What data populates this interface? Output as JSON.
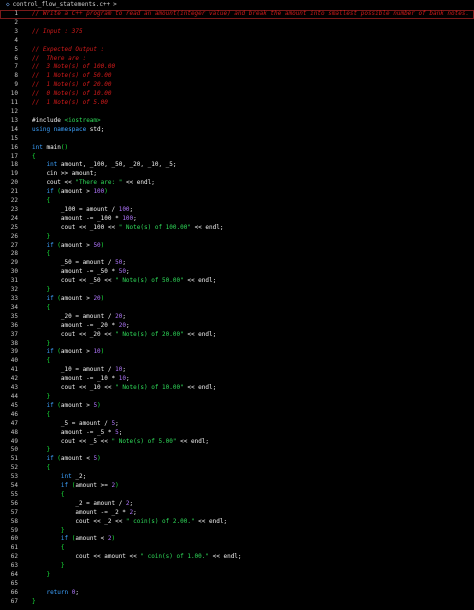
{
  "breadcrumb": {
    "icon": "cpp-file-icon",
    "file_name": "control_flow_statements.c++",
    "separator": ">"
  },
  "colors": {
    "comment": "#d11a1a",
    "keyword": "#3da2ff",
    "number": "#b277ff",
    "string": "#2fdc5a",
    "bracket": "#18e63a",
    "text": "#f2f2f2",
    "background": "#000000"
  },
  "lines": [
    {
      "n": "1",
      "t": [
        [
          "comment",
          "// Write a C++ program to read an amount(integer value) and break the amount into smallest possible number of bank notes."
        ]
      ]
    },
    {
      "n": "2",
      "t": []
    },
    {
      "n": "3",
      "t": [
        [
          "comment",
          "// Input : 375"
        ]
      ]
    },
    {
      "n": "4",
      "t": []
    },
    {
      "n": "5",
      "t": [
        [
          "comment",
          "// Expected Output :"
        ]
      ]
    },
    {
      "n": "6",
      "t": [
        [
          "comment",
          "//  There are :"
        ]
      ]
    },
    {
      "n": "7",
      "t": [
        [
          "comment",
          "//  3 Note(s) of 100.00"
        ]
      ]
    },
    {
      "n": "8",
      "t": [
        [
          "comment",
          "//  1 Note(s) of 50.00"
        ]
      ]
    },
    {
      "n": "9",
      "t": [
        [
          "comment",
          "//  1 Note(s) of 20.00"
        ]
      ]
    },
    {
      "n": "10",
      "t": [
        [
          "comment",
          "//  0 Note(s) of 10.00"
        ]
      ]
    },
    {
      "n": "11",
      "t": [
        [
          "comment",
          "//  1 Note(s) of 5.00"
        ]
      ]
    },
    {
      "n": "12",
      "t": []
    },
    {
      "n": "13",
      "t": [
        [
          "pre",
          "#include "
        ],
        [
          "inc",
          "<iostream>"
        ]
      ]
    },
    {
      "n": "14",
      "t": [
        [
          "kw",
          "using namespace "
        ],
        [
          "plain",
          "std;"
        ]
      ]
    },
    {
      "n": "15",
      "t": []
    },
    {
      "n": "16",
      "t": [
        [
          "kw",
          "int "
        ],
        [
          "fn",
          "main"
        ],
        [
          "br",
          "()"
        ]
      ]
    },
    {
      "n": "17",
      "t": [
        [
          "br",
          "{"
        ]
      ]
    },
    {
      "n": "18",
      "t": [
        [
          "plain",
          "    "
        ],
        [
          "kw",
          "int "
        ],
        [
          "plain",
          "amount, _100, _50, _20, _10, _5;"
        ]
      ]
    },
    {
      "n": "19",
      "t": [
        [
          "plain",
          "    cin >> amount;"
        ]
      ]
    },
    {
      "n": "20",
      "t": [
        [
          "plain",
          "    cout << "
        ],
        [
          "str",
          "\"There are: \""
        ],
        [
          "plain",
          " << endl;"
        ]
      ]
    },
    {
      "n": "21",
      "t": [
        [
          "plain",
          "    "
        ],
        [
          "kw",
          "if "
        ],
        [
          "br",
          "("
        ],
        [
          "plain",
          "amount > "
        ],
        [
          "num",
          "100"
        ],
        [
          "br",
          ")"
        ]
      ]
    },
    {
      "n": "22",
      "t": [
        [
          "plain",
          "    "
        ],
        [
          "br",
          "{"
        ]
      ]
    },
    {
      "n": "23",
      "t": [
        [
          "plain",
          "        _100 = amount / "
        ],
        [
          "num",
          "100"
        ],
        [
          "plain",
          ";"
        ]
      ]
    },
    {
      "n": "24",
      "t": [
        [
          "plain",
          "        amount -= _100 * "
        ],
        [
          "num",
          "100"
        ],
        [
          "plain",
          ";"
        ]
      ]
    },
    {
      "n": "25",
      "t": [
        [
          "plain",
          "        cout << _100 << "
        ],
        [
          "str",
          "\" Note(s) of 100.00\""
        ],
        [
          "plain",
          " << endl;"
        ]
      ]
    },
    {
      "n": "26",
      "t": [
        [
          "plain",
          "    "
        ],
        [
          "br",
          "}"
        ]
      ]
    },
    {
      "n": "27",
      "t": [
        [
          "plain",
          "    "
        ],
        [
          "kw",
          "if "
        ],
        [
          "br",
          "("
        ],
        [
          "plain",
          "amount > "
        ],
        [
          "num",
          "50"
        ],
        [
          "br",
          ")"
        ]
      ]
    },
    {
      "n": "28",
      "t": [
        [
          "plain",
          "    "
        ],
        [
          "br",
          "{"
        ]
      ]
    },
    {
      "n": "29",
      "t": [
        [
          "plain",
          "        _50 = amount / "
        ],
        [
          "num",
          "50"
        ],
        [
          "plain",
          ";"
        ]
      ]
    },
    {
      "n": "30",
      "t": [
        [
          "plain",
          "        amount -= _50 * "
        ],
        [
          "num",
          "50"
        ],
        [
          "plain",
          ";"
        ]
      ]
    },
    {
      "n": "31",
      "t": [
        [
          "plain",
          "        cout << _50 << "
        ],
        [
          "str",
          "\" Note(s) of 50.00\""
        ],
        [
          "plain",
          " << endl;"
        ]
      ]
    },
    {
      "n": "32",
      "t": [
        [
          "plain",
          "    "
        ],
        [
          "br",
          "}"
        ]
      ]
    },
    {
      "n": "33",
      "t": [
        [
          "plain",
          "    "
        ],
        [
          "kw",
          "if "
        ],
        [
          "br",
          "("
        ],
        [
          "plain",
          "amount > "
        ],
        [
          "num",
          "20"
        ],
        [
          "br",
          ")"
        ]
      ]
    },
    {
      "n": "34",
      "t": [
        [
          "plain",
          "    "
        ],
        [
          "br",
          "{"
        ]
      ]
    },
    {
      "n": "35",
      "t": [
        [
          "plain",
          "        _20 = amount / "
        ],
        [
          "num",
          "20"
        ],
        [
          "plain",
          ";"
        ]
      ]
    },
    {
      "n": "36",
      "t": [
        [
          "plain",
          "        amount -= _20 * "
        ],
        [
          "num",
          "20"
        ],
        [
          "plain",
          ";"
        ]
      ]
    },
    {
      "n": "37",
      "t": [
        [
          "plain",
          "        cout << _20 << "
        ],
        [
          "str",
          "\" Note(s) of 20.00\""
        ],
        [
          "plain",
          " << endl;"
        ]
      ]
    },
    {
      "n": "38",
      "t": [
        [
          "plain",
          "    "
        ],
        [
          "br",
          "}"
        ]
      ]
    },
    {
      "n": "39",
      "t": [
        [
          "plain",
          "    "
        ],
        [
          "kw",
          "if "
        ],
        [
          "br",
          "("
        ],
        [
          "plain",
          "amount > "
        ],
        [
          "num",
          "10"
        ],
        [
          "br",
          ")"
        ]
      ]
    },
    {
      "n": "40",
      "t": [
        [
          "plain",
          "    "
        ],
        [
          "br",
          "{"
        ]
      ]
    },
    {
      "n": "41",
      "t": [
        [
          "plain",
          "        _10 = amount / "
        ],
        [
          "num",
          "10"
        ],
        [
          "plain",
          ";"
        ]
      ]
    },
    {
      "n": "42",
      "t": [
        [
          "plain",
          "        amount -= _10 * "
        ],
        [
          "num",
          "10"
        ],
        [
          "plain",
          ";"
        ]
      ]
    },
    {
      "n": "43",
      "t": [
        [
          "plain",
          "        cout << _10 << "
        ],
        [
          "str",
          "\" Note(s) of 10.00\""
        ],
        [
          "plain",
          " << endl;"
        ]
      ]
    },
    {
      "n": "44",
      "t": [
        [
          "plain",
          "    "
        ],
        [
          "br",
          "}"
        ]
      ]
    },
    {
      "n": "45",
      "t": [
        [
          "plain",
          "    "
        ],
        [
          "kw",
          "if "
        ],
        [
          "br",
          "("
        ],
        [
          "plain",
          "amount > "
        ],
        [
          "num",
          "5"
        ],
        [
          "br",
          ")"
        ]
      ]
    },
    {
      "n": "46",
      "t": [
        [
          "plain",
          "    "
        ],
        [
          "br",
          "{"
        ]
      ]
    },
    {
      "n": "47",
      "t": [
        [
          "plain",
          "        _5 = amount / "
        ],
        [
          "num",
          "5"
        ],
        [
          "plain",
          ";"
        ]
      ]
    },
    {
      "n": "48",
      "t": [
        [
          "plain",
          "        amount -= _5 * "
        ],
        [
          "num",
          "5"
        ],
        [
          "plain",
          ";"
        ]
      ]
    },
    {
      "n": "49",
      "t": [
        [
          "plain",
          "        cout << _5 << "
        ],
        [
          "str",
          "\" Note(s) of 5.00\""
        ],
        [
          "plain",
          " << endl;"
        ]
      ]
    },
    {
      "n": "50",
      "t": [
        [
          "plain",
          "    "
        ],
        [
          "br",
          "}"
        ]
      ]
    },
    {
      "n": "51",
      "t": [
        [
          "plain",
          "    "
        ],
        [
          "kw",
          "if "
        ],
        [
          "br",
          "("
        ],
        [
          "plain",
          "amount < "
        ],
        [
          "num",
          "5"
        ],
        [
          "br",
          ")"
        ]
      ]
    },
    {
      "n": "52",
      "t": [
        [
          "plain",
          "    "
        ],
        [
          "br",
          "{"
        ]
      ]
    },
    {
      "n": "53",
      "t": [
        [
          "plain",
          "        "
        ],
        [
          "kw",
          "int "
        ],
        [
          "plain",
          "_2;"
        ]
      ]
    },
    {
      "n": "54",
      "t": [
        [
          "plain",
          "        "
        ],
        [
          "kw",
          "if "
        ],
        [
          "br",
          "("
        ],
        [
          "plain",
          "amount >= "
        ],
        [
          "num",
          "2"
        ],
        [
          "br",
          ")"
        ]
      ]
    },
    {
      "n": "55",
      "t": [
        [
          "plain",
          "        "
        ],
        [
          "br",
          "{"
        ]
      ]
    },
    {
      "n": "56",
      "t": [
        [
          "plain",
          "            _2 = amount / "
        ],
        [
          "num",
          "2"
        ],
        [
          "plain",
          ";"
        ]
      ]
    },
    {
      "n": "57",
      "t": [
        [
          "plain",
          "            amount -= _2 * "
        ],
        [
          "num",
          "2"
        ],
        [
          "plain",
          ";"
        ]
      ]
    },
    {
      "n": "58",
      "t": [
        [
          "plain",
          "            cout << _2 << "
        ],
        [
          "str",
          "\" coin(s) of 2.00.\""
        ],
        [
          "plain",
          " << endl;"
        ]
      ]
    },
    {
      "n": "59",
      "t": [
        [
          "plain",
          "        "
        ],
        [
          "br",
          "}"
        ]
      ]
    },
    {
      "n": "60",
      "t": [
        [
          "plain",
          "        "
        ],
        [
          "kw",
          "if "
        ],
        [
          "br",
          "("
        ],
        [
          "plain",
          "amount < "
        ],
        [
          "num",
          "2"
        ],
        [
          "br",
          ")"
        ]
      ]
    },
    {
      "n": "61",
      "t": [
        [
          "plain",
          "        "
        ],
        [
          "br",
          "{"
        ]
      ]
    },
    {
      "n": "62",
      "t": [
        [
          "plain",
          "            cout << amount << "
        ],
        [
          "str",
          "\" coin(s) of 1.00.\""
        ],
        [
          "plain",
          " << endl;"
        ]
      ]
    },
    {
      "n": "63",
      "t": [
        [
          "plain",
          "        "
        ],
        [
          "br",
          "}"
        ]
      ]
    },
    {
      "n": "64",
      "t": [
        [
          "plain",
          "    "
        ],
        [
          "br",
          "}"
        ]
      ]
    },
    {
      "n": "65",
      "t": []
    },
    {
      "n": "66",
      "t": [
        [
          "plain",
          "    "
        ],
        [
          "kw",
          "return "
        ],
        [
          "num",
          "0"
        ],
        [
          "plain",
          ";"
        ]
      ]
    },
    {
      "n": "67",
      "t": [
        [
          "br",
          "}"
        ]
      ]
    }
  ]
}
